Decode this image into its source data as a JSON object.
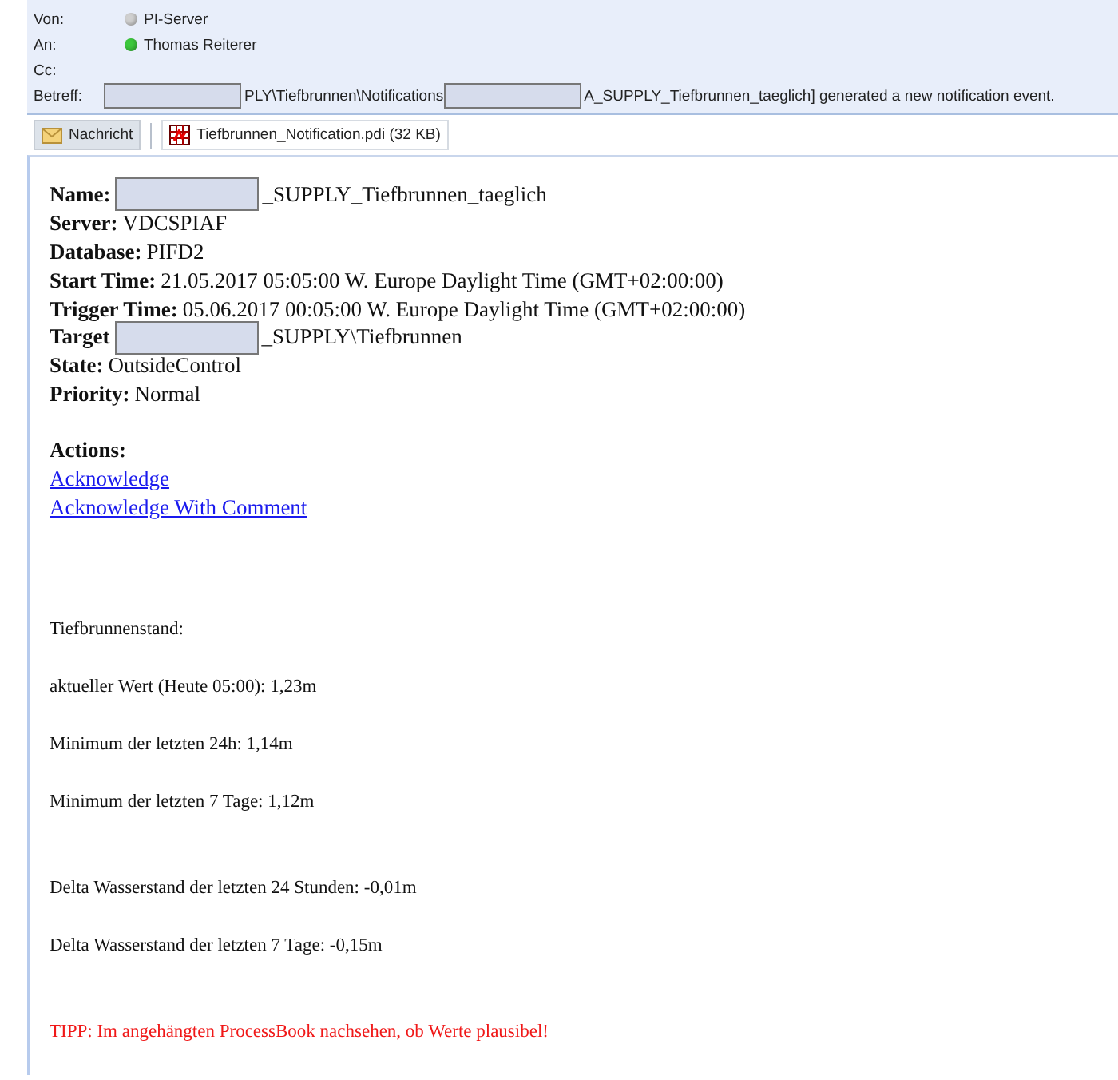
{
  "header": {
    "fields": [
      {
        "label": "Von:",
        "value": "PI-Server",
        "color": "#d0d0d0"
      },
      {
        "label": "An:",
        "value": "Thomas Reiterer",
        "color": "#3cc83c"
      },
      {
        "label": "Cc:"
      },
      {
        "label": "Betreff:",
        "parts": [
          {
            "kind": "redacted"
          },
          {
            "kind": "text",
            "text": "PLY\\Tiefbrunnen\\Notifications"
          },
          {
            "kind": "redacted"
          },
          {
            "kind": "text",
            "text": "A_SUPPLY_Tiefbrunnen_taeglich] generated a new notification event."
          }
        ]
      }
    ]
  },
  "attachments": [
    {
      "kind": "message",
      "label": "Nachricht",
      "selected": true
    },
    {
      "kind": "file",
      "label": "Tiefbrunnen_Notification.pdi (32 KB)",
      "selected": false
    }
  ],
  "body": {
    "details": [
      {
        "label": "Name:",
        "parts": [
          {
            "kind": "redacted"
          },
          {
            "kind": "text",
            "text": "_SUPPLY_Tiefbrunnen_taeglich"
          }
        ]
      },
      {
        "label": "Server:",
        "parts": [
          {
            "kind": "text",
            "text": "VDCSPIAF"
          }
        ]
      },
      {
        "label": "Database:",
        "parts": [
          {
            "kind": "text",
            "text": "PIFD2"
          }
        ]
      },
      {
        "label": "Start Time:",
        "parts": [
          {
            "kind": "text",
            "text": "21.05.2017 05:05:00 W. Europe Daylight Time (GMT+02:00:00)"
          }
        ]
      },
      {
        "label": "Trigger Time:",
        "parts": [
          {
            "kind": "text",
            "text": "05.06.2017 00:05:00 W. Europe Daylight Time (GMT+02:00:00)"
          }
        ]
      },
      {
        "label": "Target",
        "parts": [
          {
            "kind": "redacted"
          },
          {
            "kind": "text",
            "text": "_SUPPLY\\Tiefbrunnen"
          }
        ]
      },
      {
        "label": "State:",
        "parts": [
          {
            "kind": "text",
            "text": "OutsideControl"
          }
        ]
      },
      {
        "label": "Priority:",
        "parts": [
          {
            "kind": "text",
            "text": "Normal"
          }
        ]
      }
    ],
    "actions_title": "Actions:",
    "links": [
      "Acknowledge",
      "Acknowledge With Comment"
    ],
    "paragraphs": [
      {
        "kind": "plain",
        "text": "Tiefbrunnenstand:"
      },
      {
        "kind": "plain",
        "text": "aktueller Wert (Heute 05:00): 1,23m"
      },
      {
        "kind": "plain",
        "text": "Minimum der letzten 24h: 1,14m"
      },
      {
        "kind": "plain",
        "text": "Minimum der letzten 7 Tage: 1,12m",
        "gap_after": true
      },
      {
        "kind": "plain",
        "text": "Delta Wasserstand der letzten 24 Stunden: -0,01m"
      },
      {
        "kind": "plain",
        "text": "Delta Wasserstand der letzten 7 Tage: -0,15m",
        "gap_after": true
      },
      {
        "kind": "tip",
        "text": "TIPP: Im angehängten ProcessBook nachsehen, ob Werte plausibel!"
      }
    ]
  }
}
